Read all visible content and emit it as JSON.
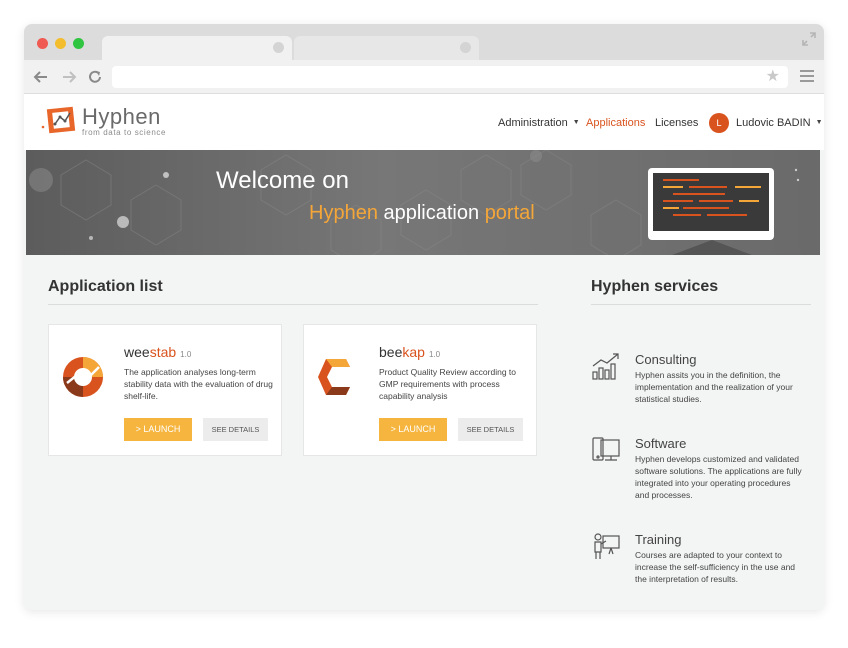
{
  "header": {
    "brand": "Hyphen",
    "tagline": "from data to science",
    "nav": {
      "administration": "Administration",
      "applications": "Applications",
      "licenses": "Licenses",
      "user_initial": "L",
      "user_name": "Ludovic BADIN"
    }
  },
  "banner": {
    "line1": "Welcome on",
    "line2_part1": "Hyphen",
    "line2_part2": " application ",
    "line2_part3": "portal"
  },
  "app_list": {
    "title": "Application list",
    "apps": [
      {
        "name_prefix": "wee",
        "name_suffix": "stab",
        "version": "1.0",
        "description": "The application analyses long-term stability data with the evaluation of drug shelf-life.",
        "launch_label": "> LAUNCH",
        "details_label": "SEE DETAILS"
      },
      {
        "name_prefix": "bee",
        "name_suffix": "kap",
        "version": "1.0",
        "description": "Product Quality Review according to GMP requirements with process capability analysis",
        "launch_label": "> LAUNCH",
        "details_label": "SEE DETAILS"
      }
    ]
  },
  "services": {
    "title": "Hyphen services",
    "items": [
      {
        "title": "Consulting",
        "icon": "chart-growth-icon",
        "description": "Hyphen assits you in the definition, the implementation and the realization of your statistical studies."
      },
      {
        "title": "Software",
        "icon": "devices-icon",
        "description": "Hyphen develops customized and validated software solutions. The applications are fully integrated into your operating procedures and processes."
      },
      {
        "title": "Training",
        "icon": "presenter-board-icon",
        "description": "Courses are adapted to your context to increase the self-sufficiency in the use and the interpretation of results."
      }
    ]
  },
  "colors": {
    "accent": "#d9531e",
    "highlight": "#f5a638",
    "launch": "#f5b53f"
  }
}
